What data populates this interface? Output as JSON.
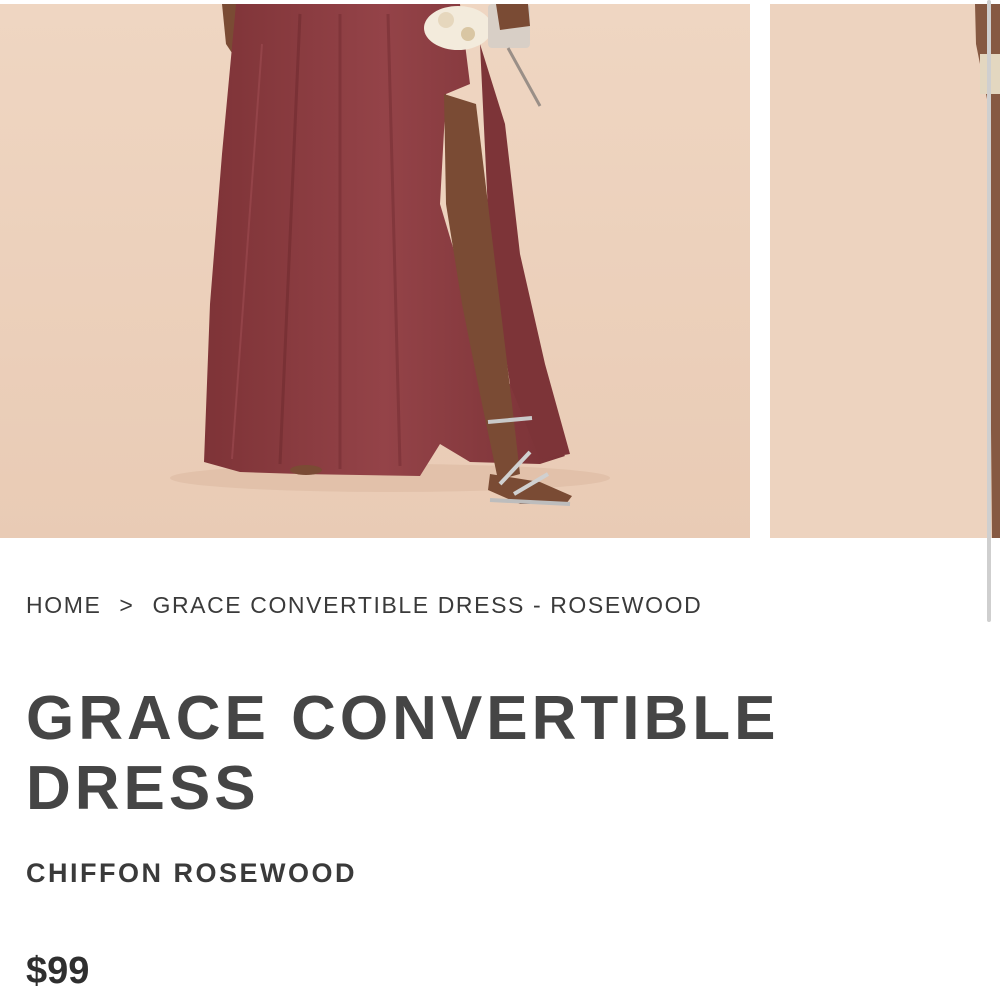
{
  "gallery": {
    "images": [
      {
        "alt": "Model wearing the Grace Convertible Dress in Rosewood"
      },
      {
        "alt": "Next product image"
      }
    ],
    "colors": {
      "backdrop": "#edd3bf",
      "dress": "#8a3b3f",
      "skin": "#7a4b34"
    }
  },
  "breadcrumb": {
    "home": "HOME",
    "separator": ">",
    "current": "GRACE CONVERTIBLE DRESS - ROSEWOOD"
  },
  "product": {
    "title": "GRACE CONVERTIBLE DRESS",
    "subtitle": "CHIFFON ROSEWOOD",
    "price": "$99"
  }
}
